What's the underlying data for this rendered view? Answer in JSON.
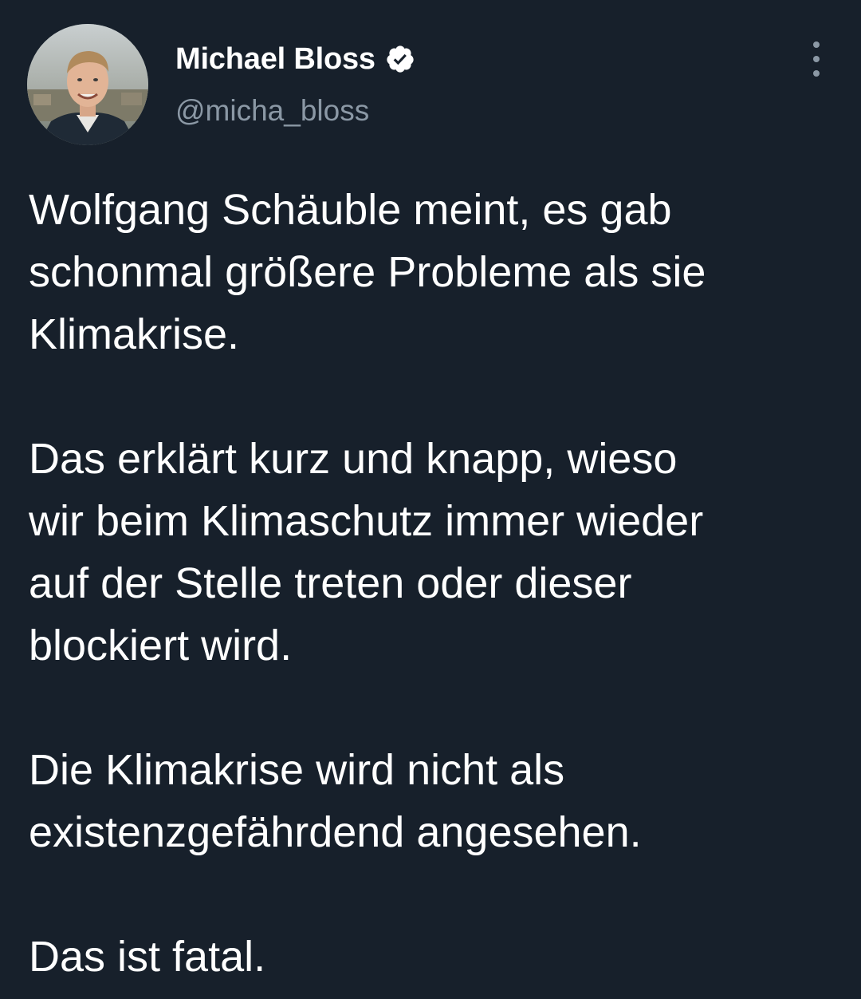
{
  "author": {
    "display_name": "Michael Bloss",
    "handle": "@micha_bloss",
    "verified_icon": "verified-badge-icon",
    "avatar": "profile-photo"
  },
  "menu": {
    "icon": "more-vertical-icon"
  },
  "tweet": {
    "paragraphs": [
      {
        "lines": [
          "Wolfgang Schäuble meint, es gab",
          "schonmal größere Probleme als sie",
          "Klimakrise."
        ]
      },
      {
        "lines": [
          "Das erklärt kurz und knapp, wieso",
          "wir beim Klimaschutz immer wieder",
          "auf der Stelle treten oder dieser",
          "blockiert wird."
        ]
      },
      {
        "lines": [
          "Die Klimakrise wird nicht als",
          "existenzgefährdend angesehen."
        ]
      },
      {
        "lines": [
          "Das ist fatal."
        ]
      }
    ]
  },
  "colors": {
    "background": "#17202b",
    "text_primary": "#ffffff",
    "text_secondary": "#8b98a5"
  }
}
